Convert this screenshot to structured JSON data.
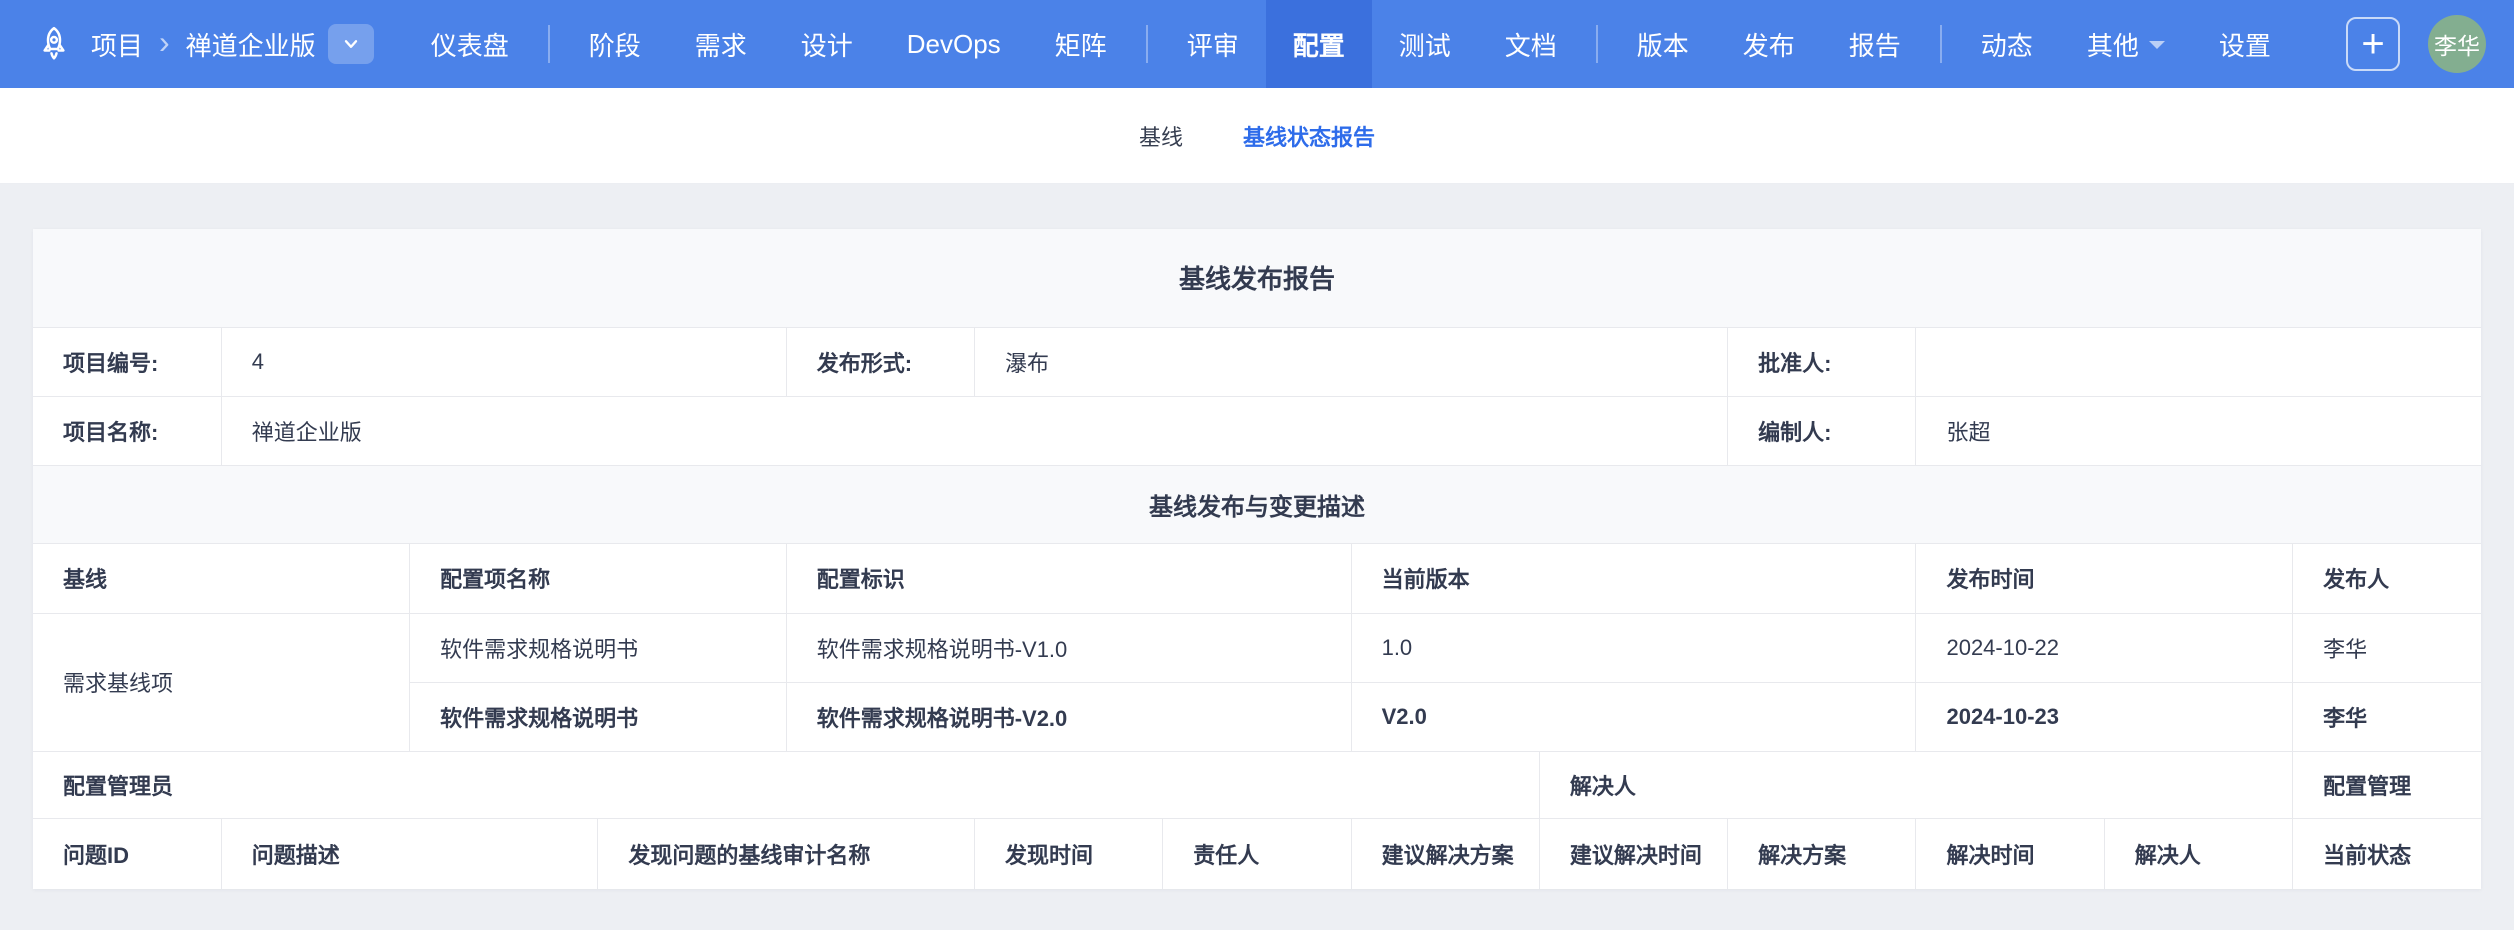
{
  "colors": {
    "navbar_bg": "#4b82e8",
    "navbar_active_bg": "#3b70dd",
    "tab_active": "#2e6cea",
    "avatar_bg": "#83ae90",
    "page_bg": "#edeff3",
    "band_bg": "#f8f9fb",
    "table_border": "#e8e9ed",
    "text": "#333b50"
  },
  "navbar": {
    "breadcrumb": {
      "root": "项目",
      "project": "禅道企业版"
    },
    "items": [
      {
        "label": "仪表盘"
      },
      {
        "label": "阶段"
      },
      {
        "label": "需求"
      },
      {
        "label": "设计"
      },
      {
        "label": "DevOps"
      },
      {
        "label": "矩阵"
      },
      {
        "label": "评审"
      },
      {
        "label": "配置",
        "active": true
      },
      {
        "label": "测试"
      },
      {
        "label": "文档"
      },
      {
        "label": "版本"
      },
      {
        "label": "发布"
      },
      {
        "label": "报告"
      },
      {
        "label": "动态"
      },
      {
        "label": "其他"
      },
      {
        "label": "设置"
      }
    ],
    "add_label": "+",
    "avatar": "李华"
  },
  "tabbar": {
    "tabs": [
      {
        "label": "基线",
        "active": false
      },
      {
        "label": "基线状态报告",
        "active": true
      }
    ]
  },
  "report": {
    "title": "基线发布报告",
    "info": {
      "project_id": {
        "label": "项目编号:",
        "value": "4"
      },
      "release_form": {
        "label": "发布形式:",
        "value": "瀑布"
      },
      "approver": {
        "label": "批准人:",
        "value": ""
      },
      "project_name": {
        "label": "项目名称:",
        "value": "禅道企业版"
      },
      "compiler": {
        "label": "编制人:",
        "value": "张超"
      }
    },
    "section_title": "基线发布与变更描述",
    "baseline": {
      "headers": [
        "基线",
        "配置项名称",
        "配置标识",
        "当前版本",
        "发布时间",
        "发布人"
      ],
      "group_label": "需求基线项",
      "rows": [
        {
          "name": "软件需求规格说明书",
          "identifier": "软件需求规格说明书-V1.0",
          "version": "1.0",
          "date": "2024-10-22",
          "publisher": "李华"
        },
        {
          "name": "软件需求规格说明书",
          "identifier": "软件需求规格说明书-V2.0",
          "version": "V2.0",
          "date": "2024-10-23",
          "publisher": "李华"
        }
      ]
    },
    "admin_row": {
      "left": "配置管理员",
      "middle": "解决人",
      "right": "配置管理"
    },
    "issue_headers": [
      "问题ID",
      "问题描述",
      "发现问题的基线审计名称",
      "发现时间",
      "责任人",
      "建议解决方案",
      "建议解决时间",
      "解决方案",
      "解决时间",
      "解决人",
      "当前状态"
    ]
  }
}
